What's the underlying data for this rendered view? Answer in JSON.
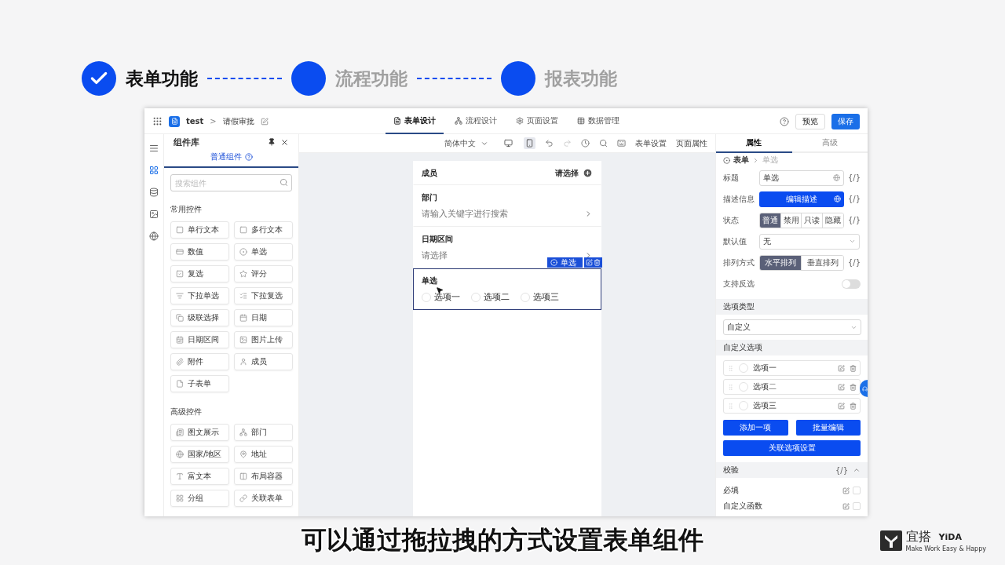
{
  "steps": [
    {
      "label": "表单功能",
      "done": true
    },
    {
      "label": "流程功能",
      "done": false
    },
    {
      "label": "报表功能",
      "done": false
    }
  ],
  "app": {
    "header": {
      "app_name": "test",
      "separator": ">",
      "page_name": "请假审批",
      "preview": "预览",
      "save": "保存",
      "tabs": [
        {
          "label": "表单设计",
          "selected": true
        },
        {
          "label": "流程设计",
          "selected": false
        },
        {
          "label": "页面设置",
          "selected": false
        },
        {
          "label": "数据管理",
          "selected": false
        }
      ]
    },
    "rail": [
      {
        "kind": "outline",
        "selected": false
      },
      {
        "kind": "components",
        "selected": true
      },
      {
        "kind": "data",
        "selected": false
      },
      {
        "kind": "media",
        "selected": false
      },
      {
        "kind": "global",
        "selected": false
      }
    ],
    "library": {
      "title": "组件库",
      "tab": "普通组件",
      "search_placeholder": "搜索组件",
      "groups": [
        {
          "title": "常用控件",
          "items": [
            "单行文本",
            "多行文本",
            "数值",
            "单选",
            "复选",
            "评分",
            "下拉单选",
            "下拉复选",
            "级联选择",
            "日期",
            "日期区间",
            "图片上传",
            "附件",
            "成员",
            "子表单"
          ]
        },
        {
          "title": "高级控件",
          "items": [
            "图文展示",
            "部门",
            "国家/地区",
            "地址",
            "富文本",
            "布局容器",
            "分组",
            "关联表单"
          ]
        }
      ]
    },
    "canvas": {
      "language": "简体中文",
      "devices": [
        {
          "kind": "desktop",
          "selected": false
        },
        {
          "kind": "mobile",
          "selected": true
        }
      ],
      "history": [
        {
          "kind": "undo",
          "disabled": false
        },
        {
          "kind": "redo",
          "disabled": true
        }
      ],
      "links": [
        "表单设置",
        "页面属性"
      ],
      "field_tag": "单选",
      "fields": [
        {
          "kind": "member",
          "label": "成员",
          "value": "请选择",
          "selected": false
        },
        {
          "kind": "picker",
          "label": "部门",
          "placeholder": "请输入关键字进行搜索",
          "selected": false
        },
        {
          "kind": "picker",
          "label": "日期区间",
          "placeholder": "请选择",
          "selected": false
        },
        {
          "kind": "radio",
          "label": "单选",
          "selected": true,
          "options": [
            {
              "label": "选项一",
              "selected": false
            },
            {
              "label": "选项二",
              "selected": false
            },
            {
              "label": "选项三",
              "selected": false
            }
          ]
        }
      ]
    },
    "properties": {
      "tabs": [
        {
          "label": "属性",
          "selected": true
        },
        {
          "label": "高级",
          "selected": false
        }
      ],
      "breadcrumb": [
        "表单",
        "单选"
      ],
      "rows": [
        {
          "kind": "input",
          "label": "标题",
          "value": "单选",
          "expr": "{/}"
        },
        {
          "kind": "button",
          "label": "描述信息",
          "value": "编辑描述",
          "expr": "{/}"
        },
        {
          "kind": "segmented",
          "label": "状态",
          "options": [
            {
              "label": "普通",
              "selected": true
            },
            {
              "label": "禁用",
              "selected": false
            },
            {
              "label": "只读",
              "selected": false
            },
            {
              "label": "隐藏",
              "selected": false
            }
          ],
          "expr": "{/}"
        },
        {
          "kind": "select",
          "label": "默认值",
          "value": "无"
        },
        {
          "kind": "segmented",
          "label": "排列方式",
          "options": [
            {
              "label": "水平排列",
              "selected": true
            },
            {
              "label": "垂直排列",
              "selected": false
            }
          ],
          "expr": "{/}"
        },
        {
          "kind": "toggle",
          "label": "支持反选",
          "on": false
        }
      ],
      "option_type": {
        "title": "选项类型",
        "value": "自定义"
      },
      "custom_options": {
        "title": "自定义选项",
        "items": [
          "选项一",
          "选项二",
          "选项三"
        ],
        "buttons": [
          "添加一项",
          "批量编辑"
        ],
        "link_button": "关联选项设置"
      },
      "validation": {
        "title": "校验",
        "expr": "{/}",
        "expanded": true,
        "rules": [
          {
            "label": "必填",
            "checked": false
          },
          {
            "label": "自定义函数",
            "checked": false
          }
        ]
      }
    }
  },
  "caption": "可以通过拖拉拽的方式设置表单组件",
  "brand": {
    "name": "宜搭",
    "latin": "YiDA",
    "slogan": "Make Work Easy & Happy"
  }
}
